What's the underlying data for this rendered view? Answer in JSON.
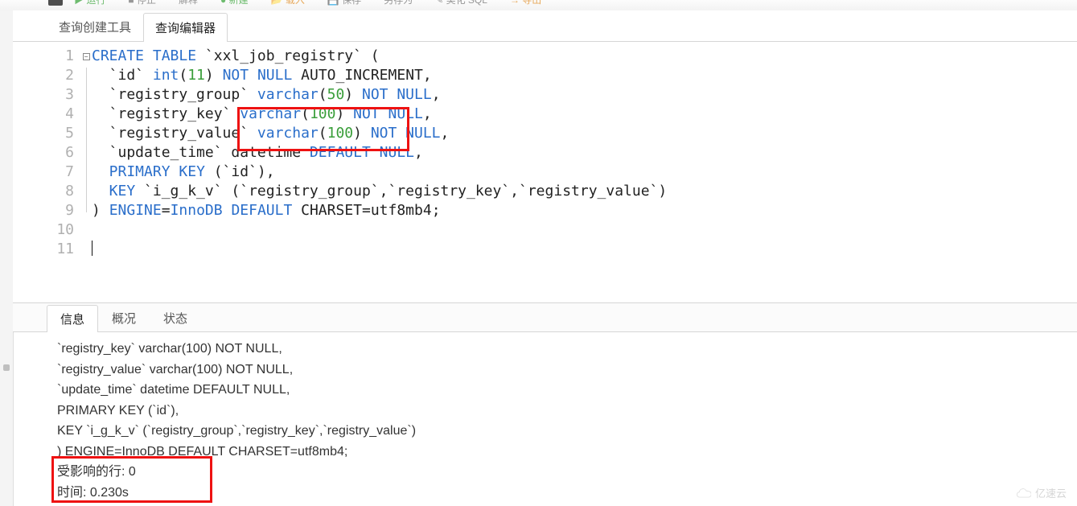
{
  "toolbar": {
    "run": "运行",
    "stop": "停止",
    "explain": "解释",
    "new": "新建",
    "load": "载入",
    "save": "保存",
    "saveas": "另存为",
    "beautify": "美化 SQL",
    "export": "导出"
  },
  "tabs": {
    "builder": "查询创建工具",
    "editor": "查询编辑器"
  },
  "editor": {
    "lines": [
      {
        "n": 1,
        "fold": "open",
        "tokens": [
          [
            "kw",
            "CREATE"
          ],
          [
            "plain",
            " "
          ],
          [
            "kw",
            "TABLE"
          ],
          [
            "plain",
            " `xxl_job_registry` ("
          ]
        ]
      },
      {
        "n": 2,
        "fold": "line",
        "tokens": [
          [
            "plain",
            "  `id` "
          ],
          [
            "kw2",
            "int"
          ],
          [
            "plain",
            "("
          ],
          [
            "num",
            "11"
          ],
          [
            "plain",
            ") "
          ],
          [
            "kw",
            "NOT"
          ],
          [
            "plain",
            " "
          ],
          [
            "kw",
            "NULL"
          ],
          [
            "plain",
            " AUTO_INCREMENT,"
          ]
        ]
      },
      {
        "n": 3,
        "fold": "line",
        "tokens": [
          [
            "plain",
            "  `registry_group` "
          ],
          [
            "kw2",
            "varchar"
          ],
          [
            "plain",
            "("
          ],
          [
            "num",
            "50"
          ],
          [
            "plain",
            ") "
          ],
          [
            "kw",
            "NOT"
          ],
          [
            "plain",
            " "
          ],
          [
            "kw",
            "NULL"
          ],
          [
            "plain",
            ","
          ]
        ]
      },
      {
        "n": 4,
        "fold": "line",
        "tokens": [
          [
            "plain",
            "  `registry_key` "
          ],
          [
            "kw2",
            "varchar"
          ],
          [
            "plain",
            "("
          ],
          [
            "num",
            "100"
          ],
          [
            "plain",
            ") "
          ],
          [
            "kw",
            "NOT"
          ],
          [
            "plain",
            " "
          ],
          [
            "kw",
            "NULL"
          ],
          [
            "plain",
            ","
          ]
        ]
      },
      {
        "n": 5,
        "fold": "line",
        "tokens": [
          [
            "plain",
            "  `registry_value` "
          ],
          [
            "kw2",
            "varchar"
          ],
          [
            "plain",
            "("
          ],
          [
            "num",
            "100"
          ],
          [
            "plain",
            ") "
          ],
          [
            "kw",
            "NOT"
          ],
          [
            "plain",
            " "
          ],
          [
            "kw",
            "NULL"
          ],
          [
            "plain",
            ","
          ]
        ]
      },
      {
        "n": 6,
        "fold": "line",
        "tokens": [
          [
            "plain",
            "  `update_time` datetime "
          ],
          [
            "kw",
            "DEFAULT"
          ],
          [
            "plain",
            " "
          ],
          [
            "kw",
            "NULL"
          ],
          [
            "plain",
            ","
          ]
        ]
      },
      {
        "n": 7,
        "fold": "line",
        "tokens": [
          [
            "kw",
            "  PRIMARY"
          ],
          [
            "plain",
            " "
          ],
          [
            "kw",
            "KEY"
          ],
          [
            "plain",
            " (`id`),"
          ]
        ]
      },
      {
        "n": 8,
        "fold": "line",
        "tokens": [
          [
            "kw",
            "  KEY"
          ],
          [
            "plain",
            " `i_g_k_v` (`registry_group`,`registry_key`,`registry_value`)"
          ]
        ]
      },
      {
        "n": 9,
        "fold": "close",
        "tokens": [
          [
            "plain",
            ") "
          ],
          [
            "kw",
            "ENGINE"
          ],
          [
            "plain",
            "="
          ],
          [
            "kw2",
            "InnoDB"
          ],
          [
            "plain",
            " "
          ],
          [
            "kw",
            "DEFAULT"
          ],
          [
            "plain",
            " CHARSET=utf8mb4;"
          ]
        ]
      },
      {
        "n": 10,
        "fold": "",
        "tokens": []
      },
      {
        "n": 11,
        "fold": "",
        "tokens": []
      }
    ]
  },
  "info_tabs": {
    "info": "信息",
    "profile": "概况",
    "status": "状态"
  },
  "info_messages": [
    "`registry_key` varchar(100) NOT NULL,",
    "`registry_value` varchar(100) NOT NULL,",
    "`update_time` datetime DEFAULT NULL,",
    "PRIMARY KEY (`id`),",
    "KEY `i_g_k_v` (`registry_group`,`registry_key`,`registry_value`)",
    ") ENGINE=InnoDB DEFAULT CHARSET=utf8mb4;",
    "受影响的行: 0",
    "时间: 0.230s"
  ],
  "watermark": "亿速云"
}
